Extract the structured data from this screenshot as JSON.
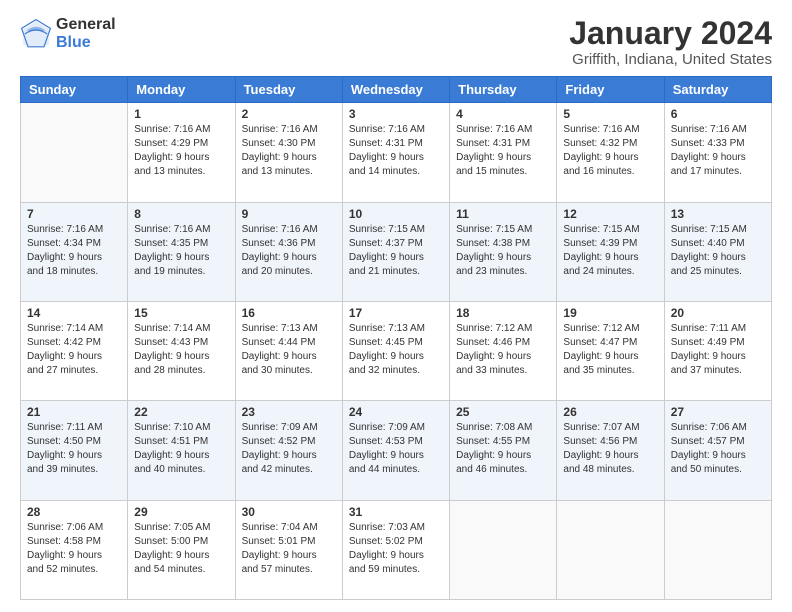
{
  "logo": {
    "general": "General",
    "blue": "Blue"
  },
  "title": "January 2024",
  "subtitle": "Griffith, Indiana, United States",
  "days_of_week": [
    "Sunday",
    "Monday",
    "Tuesday",
    "Wednesday",
    "Thursday",
    "Friday",
    "Saturday"
  ],
  "weeks": [
    [
      {
        "day": "",
        "empty": true
      },
      {
        "day": "1",
        "sunrise": "Sunrise: 7:16 AM",
        "sunset": "Sunset: 4:29 PM",
        "daylight": "Daylight: 9 hours and 13 minutes."
      },
      {
        "day": "2",
        "sunrise": "Sunrise: 7:16 AM",
        "sunset": "Sunset: 4:30 PM",
        "daylight": "Daylight: 9 hours and 13 minutes."
      },
      {
        "day": "3",
        "sunrise": "Sunrise: 7:16 AM",
        "sunset": "Sunset: 4:31 PM",
        "daylight": "Daylight: 9 hours and 14 minutes."
      },
      {
        "day": "4",
        "sunrise": "Sunrise: 7:16 AM",
        "sunset": "Sunset: 4:31 PM",
        "daylight": "Daylight: 9 hours and 15 minutes."
      },
      {
        "day": "5",
        "sunrise": "Sunrise: 7:16 AM",
        "sunset": "Sunset: 4:32 PM",
        "daylight": "Daylight: 9 hours and 16 minutes."
      },
      {
        "day": "6",
        "sunrise": "Sunrise: 7:16 AM",
        "sunset": "Sunset: 4:33 PM",
        "daylight": "Daylight: 9 hours and 17 minutes."
      }
    ],
    [
      {
        "day": "7",
        "sunrise": "Sunrise: 7:16 AM",
        "sunset": "Sunset: 4:34 PM",
        "daylight": "Daylight: 9 hours and 18 minutes."
      },
      {
        "day": "8",
        "sunrise": "Sunrise: 7:16 AM",
        "sunset": "Sunset: 4:35 PM",
        "daylight": "Daylight: 9 hours and 19 minutes."
      },
      {
        "day": "9",
        "sunrise": "Sunrise: 7:16 AM",
        "sunset": "Sunset: 4:36 PM",
        "daylight": "Daylight: 9 hours and 20 minutes."
      },
      {
        "day": "10",
        "sunrise": "Sunrise: 7:15 AM",
        "sunset": "Sunset: 4:37 PM",
        "daylight": "Daylight: 9 hours and 21 minutes."
      },
      {
        "day": "11",
        "sunrise": "Sunrise: 7:15 AM",
        "sunset": "Sunset: 4:38 PM",
        "daylight": "Daylight: 9 hours and 23 minutes."
      },
      {
        "day": "12",
        "sunrise": "Sunrise: 7:15 AM",
        "sunset": "Sunset: 4:39 PM",
        "daylight": "Daylight: 9 hours and 24 minutes."
      },
      {
        "day": "13",
        "sunrise": "Sunrise: 7:15 AM",
        "sunset": "Sunset: 4:40 PM",
        "daylight": "Daylight: 9 hours and 25 minutes."
      }
    ],
    [
      {
        "day": "14",
        "sunrise": "Sunrise: 7:14 AM",
        "sunset": "Sunset: 4:42 PM",
        "daylight": "Daylight: 9 hours and 27 minutes."
      },
      {
        "day": "15",
        "sunrise": "Sunrise: 7:14 AM",
        "sunset": "Sunset: 4:43 PM",
        "daylight": "Daylight: 9 hours and 28 minutes."
      },
      {
        "day": "16",
        "sunrise": "Sunrise: 7:13 AM",
        "sunset": "Sunset: 4:44 PM",
        "daylight": "Daylight: 9 hours and 30 minutes."
      },
      {
        "day": "17",
        "sunrise": "Sunrise: 7:13 AM",
        "sunset": "Sunset: 4:45 PM",
        "daylight": "Daylight: 9 hours and 32 minutes."
      },
      {
        "day": "18",
        "sunrise": "Sunrise: 7:12 AM",
        "sunset": "Sunset: 4:46 PM",
        "daylight": "Daylight: 9 hours and 33 minutes."
      },
      {
        "day": "19",
        "sunrise": "Sunrise: 7:12 AM",
        "sunset": "Sunset: 4:47 PM",
        "daylight": "Daylight: 9 hours and 35 minutes."
      },
      {
        "day": "20",
        "sunrise": "Sunrise: 7:11 AM",
        "sunset": "Sunset: 4:49 PM",
        "daylight": "Daylight: 9 hours and 37 minutes."
      }
    ],
    [
      {
        "day": "21",
        "sunrise": "Sunrise: 7:11 AM",
        "sunset": "Sunset: 4:50 PM",
        "daylight": "Daylight: 9 hours and 39 minutes."
      },
      {
        "day": "22",
        "sunrise": "Sunrise: 7:10 AM",
        "sunset": "Sunset: 4:51 PM",
        "daylight": "Daylight: 9 hours and 40 minutes."
      },
      {
        "day": "23",
        "sunrise": "Sunrise: 7:09 AM",
        "sunset": "Sunset: 4:52 PM",
        "daylight": "Daylight: 9 hours and 42 minutes."
      },
      {
        "day": "24",
        "sunrise": "Sunrise: 7:09 AM",
        "sunset": "Sunset: 4:53 PM",
        "daylight": "Daylight: 9 hours and 44 minutes."
      },
      {
        "day": "25",
        "sunrise": "Sunrise: 7:08 AM",
        "sunset": "Sunset: 4:55 PM",
        "daylight": "Daylight: 9 hours and 46 minutes."
      },
      {
        "day": "26",
        "sunrise": "Sunrise: 7:07 AM",
        "sunset": "Sunset: 4:56 PM",
        "daylight": "Daylight: 9 hours and 48 minutes."
      },
      {
        "day": "27",
        "sunrise": "Sunrise: 7:06 AM",
        "sunset": "Sunset: 4:57 PM",
        "daylight": "Daylight: 9 hours and 50 minutes."
      }
    ],
    [
      {
        "day": "28",
        "sunrise": "Sunrise: 7:06 AM",
        "sunset": "Sunset: 4:58 PM",
        "daylight": "Daylight: 9 hours and 52 minutes."
      },
      {
        "day": "29",
        "sunrise": "Sunrise: 7:05 AM",
        "sunset": "Sunset: 5:00 PM",
        "daylight": "Daylight: 9 hours and 54 minutes."
      },
      {
        "day": "30",
        "sunrise": "Sunrise: 7:04 AM",
        "sunset": "Sunset: 5:01 PM",
        "daylight": "Daylight: 9 hours and 57 minutes."
      },
      {
        "day": "31",
        "sunrise": "Sunrise: 7:03 AM",
        "sunset": "Sunset: 5:02 PM",
        "daylight": "Daylight: 9 hours and 59 minutes."
      },
      {
        "day": "",
        "empty": true
      },
      {
        "day": "",
        "empty": true
      },
      {
        "day": "",
        "empty": true
      }
    ]
  ]
}
